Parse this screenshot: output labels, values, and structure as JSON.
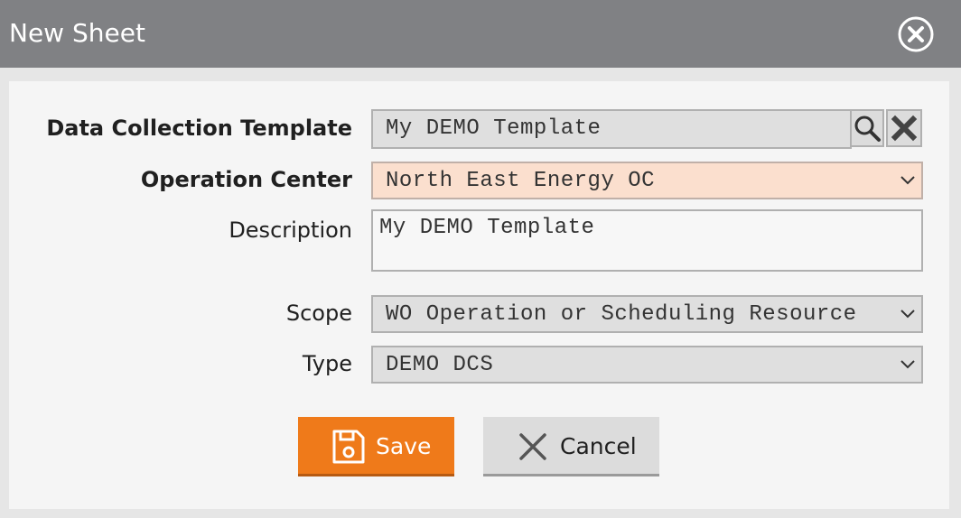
{
  "dialog": {
    "title": "New Sheet"
  },
  "form": {
    "template": {
      "label": "Data Collection Template",
      "value": "My DEMO Template"
    },
    "operation_center": {
      "label": "Operation Center",
      "value": "North East Energy OC"
    },
    "description": {
      "label": "Description",
      "value": "My DEMO Template"
    },
    "scope": {
      "label": "Scope",
      "value": "WO Operation or Scheduling Resource"
    },
    "type": {
      "label": "Type",
      "value": "DEMO DCS"
    }
  },
  "actions": {
    "save_label": "Save",
    "cancel_label": "Cancel"
  },
  "colors": {
    "titlebar": "#808184",
    "accent_save": "#ef7a1a",
    "required_field_bg": "#fbdfce"
  },
  "icons": [
    "close-circle-icon",
    "search-icon",
    "clear-x-icon",
    "chevron-down-icon",
    "floppy-disk-icon",
    "cancel-x-icon"
  ]
}
